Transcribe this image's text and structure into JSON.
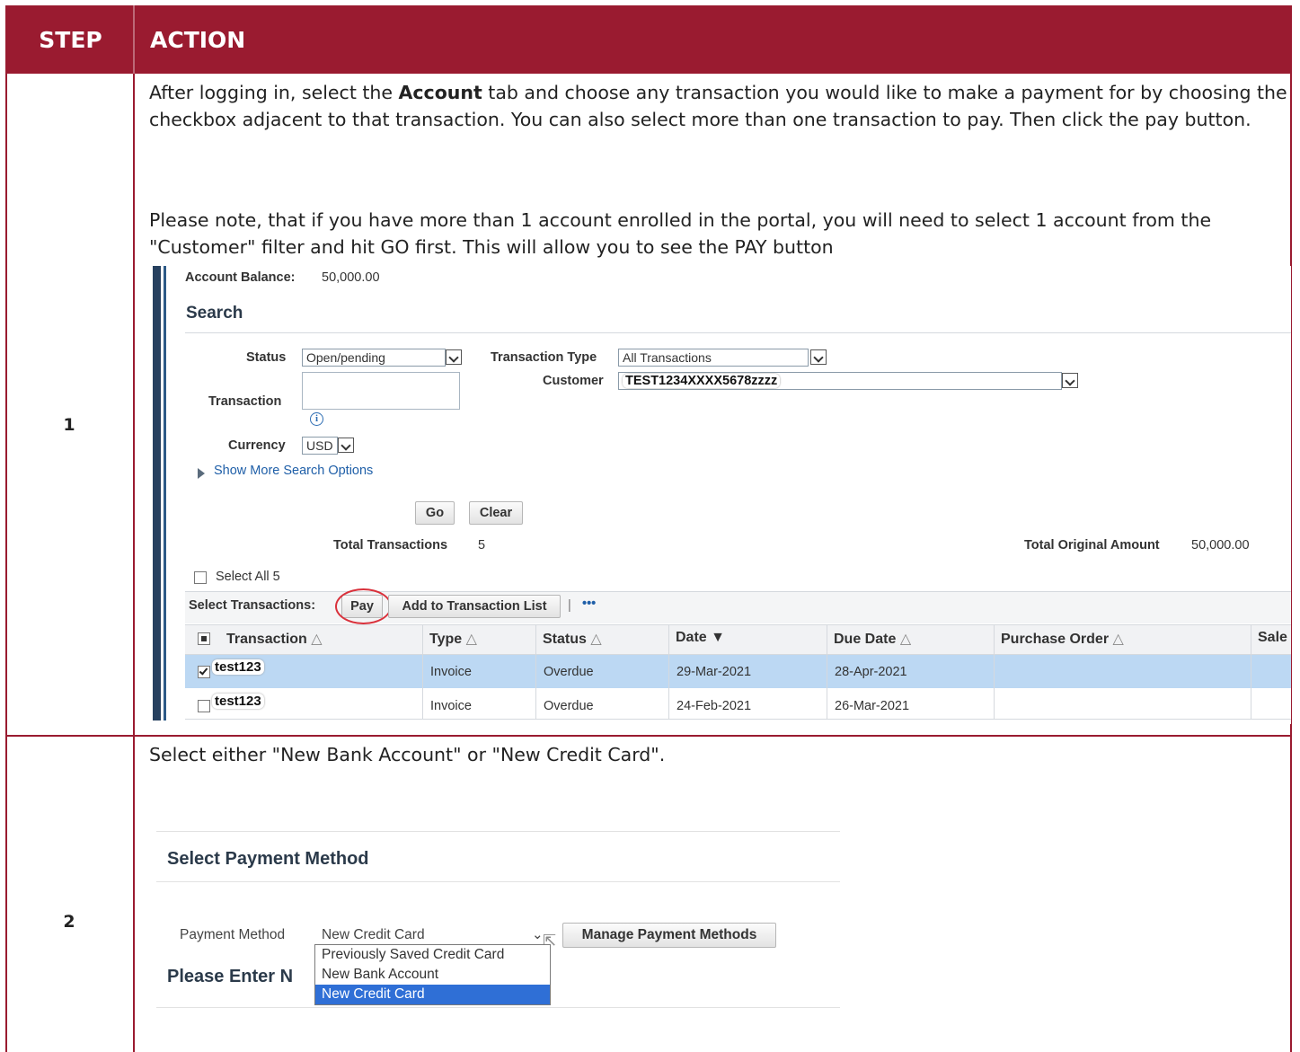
{
  "header": {
    "step": "STEP",
    "action": "ACTION"
  },
  "steps": [
    {
      "number": "1",
      "text_pre": "After logging in, select the ",
      "text_bold": "Account",
      "text_post": " tab and choose any transaction you would like to make a payment for by choosing the checkbox adjacent to that transaction. You can also select more than one transaction to pay. Then click the pay button.",
      "note": "Please note, that if you have more than 1 account enrolled in the portal, you will need to select 1 account from the \"Customer\" filter and hit GO first. This will allow you to see the PAY button"
    },
    {
      "number": "2",
      "text": "Select either \"New Bank Account\" or \"New Credit Card\"."
    }
  ],
  "screenshot1": {
    "account_balance_label": "Account Balance:",
    "account_balance_value": "50,000.00",
    "search_title": "Search",
    "status_label": "Status",
    "status_value": "Open/pending",
    "transaction_type_label": "Transaction Type",
    "transaction_type_value": "All Transactions",
    "customer_label": "Customer",
    "customer_value": "TEST1234XXXX5678zzzz",
    "transaction_label": "Transaction",
    "currency_label": "Currency",
    "currency_value": "USD",
    "show_more": "Show More Search Options",
    "go_button": "Go",
    "clear_button": "Clear",
    "total_transactions_label": "Total Transactions",
    "total_transactions_value": "5",
    "total_original_amount_label": "Total Original Amount",
    "total_original_amount_value": "50,000.00",
    "select_all": "Select All 5",
    "select_transactions_label": "Select Transactions:",
    "pay_button": "Pay",
    "add_to_list_button": "Add to Transaction List",
    "separator": "|",
    "more_dots": "•••",
    "columns": [
      "Transaction",
      "Type",
      "Status",
      "Date",
      "Due Date",
      "Purchase Order",
      "Sale"
    ],
    "rows": [
      {
        "transaction": "test123",
        "type": "Invoice",
        "status": "Overdue",
        "date": "29-Mar-2021",
        "due_date": "28-Apr-2021",
        "checked": true
      },
      {
        "transaction": "test123",
        "type": "Invoice",
        "status": "Overdue",
        "date": "24-Feb-2021",
        "due_date": "26-Mar-2021",
        "checked": false
      }
    ]
  },
  "screenshot2": {
    "title": "Select Payment Method",
    "payment_method_label": "Payment Method",
    "payment_method_value": "New Credit Card",
    "manage_button": "Manage Payment Methods",
    "options": [
      "Previously Saved Credit Card",
      "New Bank Account",
      "New Credit Card"
    ],
    "please_enter": "Please Enter N"
  },
  "colors": {
    "brand": "#9a1b30",
    "link": "#1f5fa8",
    "highlight_row": "#bcd8f3",
    "selected_option": "#2f6fd6",
    "annotation": "#d9313b"
  }
}
